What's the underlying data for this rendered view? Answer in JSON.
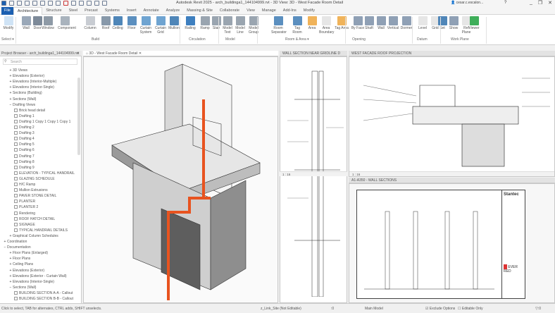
{
  "app": {
    "title": "Autodesk Revit 2025 - arch_buildinga1_144104999.rvt - 3D View: 3D - West Facade Room Detail",
    "user": "cesar.c.escalon...",
    "help": "?",
    "window_controls": [
      "_",
      "❐",
      "✕"
    ]
  },
  "ribbon_tabs": [
    "File",
    "Architecture",
    "Structure",
    "Steel",
    "Precast",
    "Systems",
    "Insert",
    "Annotate",
    "Analyze",
    "Massing & Site",
    "Collaborate",
    "View",
    "Manage",
    "Add-Ins",
    "Modify"
  ],
  "active_tab": "Architecture",
  "tools": [
    {
      "label": "Modify",
      "color": "#cfe3f5"
    },
    {
      "label": "Wall",
      "color": "#9aa8b8"
    },
    {
      "label": "Door",
      "color": "#7d8a99"
    },
    {
      "label": "Window",
      "color": "#8e9aa6"
    },
    {
      "label": "Component",
      "color": "#a9b3bd"
    },
    {
      "label": "Column",
      "color": "#c8ccd2"
    },
    {
      "label": "Roof",
      "color": "#8899aa"
    },
    {
      "label": "Ceiling",
      "color": "#4f86b8"
    },
    {
      "label": "Floor",
      "color": "#5b8fbf"
    },
    {
      "label": "Curtain System",
      "color": "#6fa4d1"
    },
    {
      "label": "Curtain Grid",
      "color": "#6fa4d1"
    },
    {
      "label": "Mullion",
      "color": "#4f86b8"
    },
    {
      "label": "Railing",
      "color": "#3e7fbf"
    },
    {
      "label": "Ramp",
      "color": "#9aa5b0"
    },
    {
      "label": "Stair",
      "color": "#9aa5b0"
    },
    {
      "label": "Model Text",
      "color": "#9aa5b0"
    },
    {
      "label": "Model Line",
      "color": "#9aa5b0"
    },
    {
      "label": "Model Group",
      "color": "#9aa5b0"
    },
    {
      "label": "Room",
      "color": "#d8d8d8"
    },
    {
      "label": "Room Separator",
      "color": "#5b8fbf"
    },
    {
      "label": "Tag Room",
      "color": "#5b8fbf"
    },
    {
      "label": "Area",
      "color": "#f0b35a"
    },
    {
      "label": "Area Boundary",
      "color": "#e6e6e6"
    },
    {
      "label": "Tag Area",
      "color": "#f0b35a"
    },
    {
      "label": "By Face",
      "color": "#8fa0b5"
    },
    {
      "label": "Shaft",
      "color": "#8fa0b5"
    },
    {
      "label": "Wall",
      "color": "#8fa0b5"
    },
    {
      "label": "Vertical",
      "color": "#8fa0b5"
    },
    {
      "label": "Dormer",
      "color": "#8fa0b5"
    },
    {
      "label": "Level",
      "color": "#e6e6e6"
    },
    {
      "label": "Grid",
      "color": "#e6e6e6"
    },
    {
      "label": "Set",
      "color": "#4f86b8"
    },
    {
      "label": "Show",
      "color": "#8fa0b5"
    },
    {
      "label": "Ref Plane",
      "color": "#e6e6e6"
    },
    {
      "label": "Viewer",
      "color": "#3fae5a"
    }
  ],
  "panels": [
    "Select ▾",
    "Build",
    "Circulation",
    "Model",
    "Room & Area ▾",
    "Opening",
    "Datum",
    "Work Plane"
  ],
  "project_browser": {
    "title": "Project Browser - arch_buildinga1_144104999.rvt",
    "search_placeholder": "Search",
    "close": "✕",
    "items": [
      {
        "l": 1,
        "t": "+",
        "label": "3D Views"
      },
      {
        "l": 1,
        "t": "+",
        "label": "Elevations (Exterior)"
      },
      {
        "l": 1,
        "t": "+",
        "label": "Elevations (Interior-Multiple)"
      },
      {
        "l": 1,
        "t": "+",
        "label": "Elevations (Interior-Single)"
      },
      {
        "l": 1,
        "t": "+",
        "label": "Sections (Building)"
      },
      {
        "l": 1,
        "t": "+",
        "label": "Sections (Wall)"
      },
      {
        "l": 1,
        "t": "−",
        "label": "Drafting Views"
      },
      {
        "l": 2,
        "label": "Brick head detail"
      },
      {
        "l": 2,
        "label": "Drafting 1"
      },
      {
        "l": 2,
        "label": "Drafting 1 Copy 1 Copy 1 Copy 1"
      },
      {
        "l": 2,
        "label": "Drafting 2"
      },
      {
        "l": 2,
        "label": "Drafting 3"
      },
      {
        "l": 2,
        "label": "Drafting 4"
      },
      {
        "l": 2,
        "label": "Drafting 5"
      },
      {
        "l": 2,
        "label": "Drafting 6"
      },
      {
        "l": 2,
        "label": "Drafting 7"
      },
      {
        "l": 2,
        "label": "Drafting 8"
      },
      {
        "l": 2,
        "label": "Drafting 9"
      },
      {
        "l": 2,
        "label": "ELEVATION - TYPICAL HANDRAIL"
      },
      {
        "l": 2,
        "label": "GLAZING SCHEDULE"
      },
      {
        "l": 2,
        "label": "H/C Ramp"
      },
      {
        "l": 2,
        "label": "Mullion Extrusions"
      },
      {
        "l": 2,
        "label": "PAVER STONE DETAIL"
      },
      {
        "l": 2,
        "label": "PLANTER"
      },
      {
        "l": 2,
        "label": "PLANTER 2"
      },
      {
        "l": 2,
        "label": "Rendering"
      },
      {
        "l": 2,
        "label": "ROOF HATCH DETAIL"
      },
      {
        "l": 2,
        "label": "SIGNAGE"
      },
      {
        "l": 2,
        "label": "TYPICAL HANDRAIL DETAILS"
      },
      {
        "l": 1,
        "t": "+",
        "label": "Graphical Column Schedules"
      },
      {
        "l": 0,
        "t": "+",
        "label": "Coordination"
      },
      {
        "l": 0,
        "t": "−",
        "label": "Documentation"
      },
      {
        "l": 1,
        "t": "+",
        "label": "Floor Plans (Enlarged)"
      },
      {
        "l": 1,
        "t": "+",
        "label": "Floor Plans"
      },
      {
        "l": 1,
        "t": "+",
        "label": "Ceiling Plans"
      },
      {
        "l": 1,
        "t": "+",
        "label": "Elevations (Exterior)"
      },
      {
        "l": 1,
        "t": "+",
        "label": "Elevations (Exterior - Curtain Wall)"
      },
      {
        "l": 1,
        "t": "+",
        "label": "Elevations (Interior-Single)"
      },
      {
        "l": 1,
        "t": "−",
        "label": "Sections (Wall)"
      },
      {
        "l": 2,
        "label": "BUILDING SECTION A-A - Callout"
      },
      {
        "l": 2,
        "label": "BUILDING SECTION B-B - Callout"
      }
    ]
  },
  "views": {
    "v3d": {
      "tab": "3D - West Facade Room Detail",
      "close": "✕"
    },
    "wall": {
      "tab": "WALL SECTION NEAR GRIDLINE D",
      "scale": "1 : 16"
    },
    "roof": {
      "tab": "WEST FACADE ROOF PROJECTION",
      "scale": "1 : 16"
    },
    "sheet": {
      "tab": "A1-A350 - WALL SECTIONS",
      "brand": "Stantec",
      "client": "EVER RED"
    }
  },
  "status": {
    "hint": "Click to select, TAB for alternates, CTRL adds, SHIFT unselects.",
    "workset": "z_Link_Site (Not Editable)",
    "zero": ":0",
    "model": "Main Model",
    "exclude": "Exclude Options",
    "editable": "Editable Only",
    "filter": ":0"
  },
  "colors": {
    "accent": "#1b5fb1",
    "pipe": "#e8531f"
  }
}
